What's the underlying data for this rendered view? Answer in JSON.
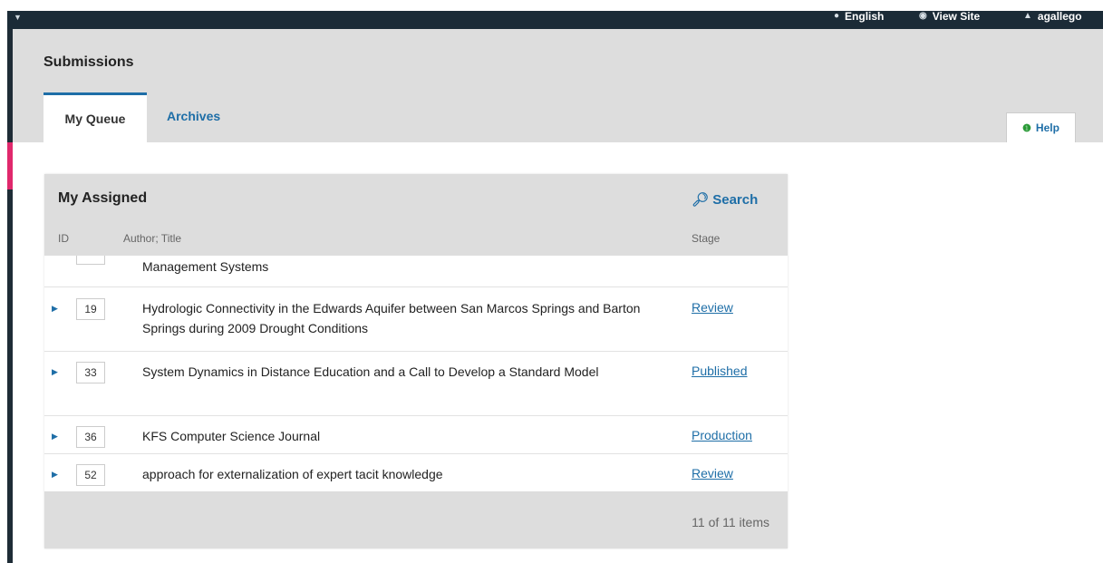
{
  "topnav": {
    "language": "English",
    "view_site": "View Site",
    "user": "agallego"
  },
  "page": {
    "title": "Submissions",
    "tabs": [
      "My Queue",
      "Archives"
    ],
    "help": "Help"
  },
  "panel": {
    "title": "My Assigned",
    "search": "Search",
    "columns": {
      "id": "ID",
      "author_title": "Author; Title",
      "stage": "Stage"
    },
    "rows": [
      {
        "id": "",
        "title": "Management Systems",
        "stage": ""
      },
      {
        "id": "19",
        "title": "Hydrologic Connectivity in the Edwards Aquifer between San Marcos Springs and Barton Springs during 2009 Drought Conditions",
        "stage": "Review"
      },
      {
        "id": "33",
        "title": "System Dynamics in Distance Education and a Call to Develop a Standard Model",
        "stage": "Published"
      },
      {
        "id": "36",
        "title": "KFS Computer Science Journal",
        "stage": "Production"
      },
      {
        "id": "52",
        "title": "approach for externalization of expert tacit knowledge",
        "stage": "Review"
      }
    ],
    "footer": "11 of 11 items"
  },
  "icons": {
    "menu_caret": "caret-down-icon",
    "language": "globe-icon",
    "view_site": "eye-icon",
    "user": "user-icon",
    "help": "info-icon",
    "search": "search-icon",
    "expand": "expand-arrow-icon"
  },
  "colors": {
    "topbar": "#1b2b37",
    "link": "#1e6ea7",
    "accent": "#e0286c",
    "header_bg": "#dddddd"
  }
}
